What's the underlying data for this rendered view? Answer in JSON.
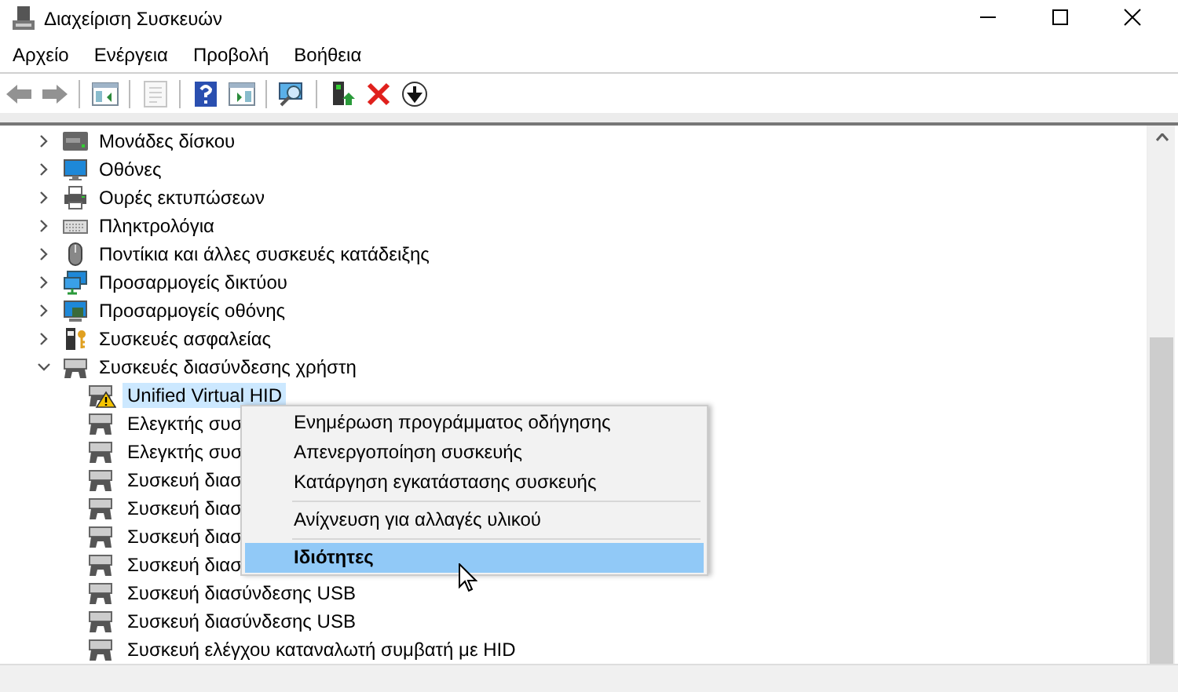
{
  "window": {
    "title": "Διαχείριση Συσκευών"
  },
  "menu": [
    "Αρχείο",
    "Ενέργεια",
    "Προβολή",
    "Βοήθεια"
  ],
  "toolbar": [
    {
      "kind": "back",
      "disabled": true
    },
    {
      "kind": "forward",
      "disabled": true
    },
    {
      "kind": "pane",
      "disabled": false
    },
    {
      "kind": "properties",
      "disabled": true
    },
    {
      "kind": "help",
      "disabled": false
    },
    {
      "kind": "run",
      "disabled": false
    },
    {
      "kind": "scan",
      "disabled": false
    },
    {
      "kind": "update",
      "disabled": false
    },
    {
      "kind": "remove",
      "disabled": false
    },
    {
      "kind": "download",
      "disabled": false
    }
  ],
  "tree": [
    {
      "label": "Μονάδες δίσκου",
      "kind": "disk",
      "expanded": false,
      "selected": false
    },
    {
      "label": "Οθόνες",
      "kind": "monitor",
      "expanded": false,
      "selected": false
    },
    {
      "label": "Ουρές εκτυπώσεων",
      "kind": "printer",
      "expanded": false,
      "selected": false
    },
    {
      "label": "Πληκτρολόγια",
      "kind": "keyboard",
      "expanded": false,
      "selected": false
    },
    {
      "label": "Ποντίκια και άλλες συσκευές κατάδειξης",
      "kind": "mouse",
      "expanded": false,
      "selected": false
    },
    {
      "label": "Προσαρμογείς δικτύου",
      "kind": "network",
      "expanded": false,
      "selected": false
    },
    {
      "label": "Προσαρμογείς οθόνης",
      "kind": "display",
      "expanded": false,
      "selected": false
    },
    {
      "label": "Συσκευές ασφαλείας",
      "kind": "security",
      "expanded": false,
      "selected": false
    },
    {
      "label": "Συσκευές διασύνδεσης χρήστη",
      "kind": "hid",
      "expanded": true,
      "selected": false,
      "children": [
        {
          "label": "Unified Virtual HID",
          "warning": true,
          "selected": true
        },
        {
          "label": "Ελεγκτής συσ",
          "warning": false,
          "selected": false
        },
        {
          "label": "Ελεγκτής συσ",
          "warning": false,
          "selected": false
        },
        {
          "label": "Συσκευή διασ",
          "warning": false,
          "selected": false
        },
        {
          "label": "Συσκευή διασ",
          "warning": false,
          "selected": false
        },
        {
          "label": "Συσκευή διασ",
          "warning": false,
          "selected": false
        },
        {
          "label": "Συσκευή διασ",
          "warning": false,
          "selected": false
        },
        {
          "label": "Συσκευή διασύνδεσης USB",
          "warning": false,
          "selected": false
        },
        {
          "label": "Συσκευή διασύνδεσης USB",
          "warning": false,
          "selected": false
        },
        {
          "label": "Συσκευή ελέγχου καταναλωτή συμβατή με HID",
          "warning": false,
          "selected": false
        }
      ]
    }
  ],
  "context_menu": [
    {
      "kind": "item",
      "label": "Ενημέρωση προγράμματος οδήγησης",
      "selected": false
    },
    {
      "kind": "item",
      "label": "Απενεργοποίηση συσκευής",
      "selected": false
    },
    {
      "kind": "item",
      "label": "Κατάργηση εγκατάστασης συσκευής",
      "selected": false
    },
    {
      "kind": "separator"
    },
    {
      "kind": "item",
      "label": "Ανίχνευση για αλλαγές υλικού",
      "selected": false
    },
    {
      "kind": "separator"
    },
    {
      "kind": "default",
      "label": "Ιδιότητες",
      "selected": true
    }
  ]
}
